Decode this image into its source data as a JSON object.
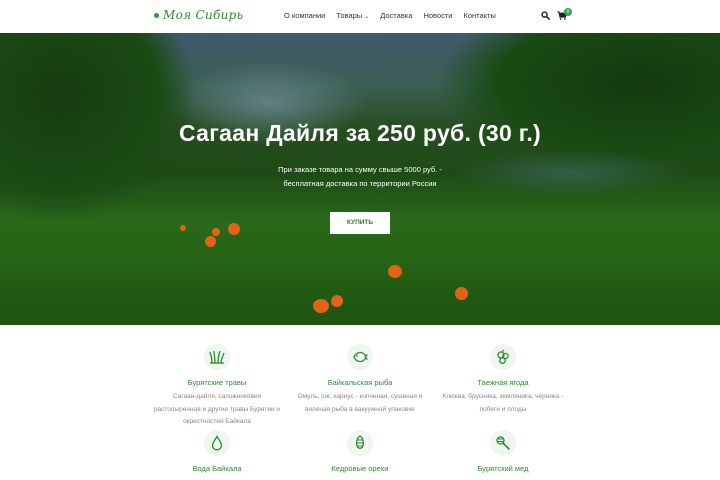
{
  "header": {
    "logo_text": "Моя Сибирь",
    "nav": [
      {
        "label": "О компании"
      },
      {
        "label": "Товары",
        "has_caret": true
      },
      {
        "label": "Доставка"
      },
      {
        "label": "Новости"
      },
      {
        "label": "Контакты"
      }
    ],
    "cart_count": "0",
    "icons": [
      "search-icon",
      "cart-icon"
    ],
    "accent_color": "#2e8b34"
  },
  "hero": {
    "title": "Сагаан Дайля за 250 руб. (30 г.)",
    "subtitle_line1": "При заказе товара на сумму свыше 5000 руб. -",
    "subtitle_line2": "бесплатная доставка по территории России",
    "button_label": "КУПИТЬ"
  },
  "categories": [
    {
      "icon": "herbs-icon",
      "title": "Бурятские травы",
      "desc": [
        "Сагаан-дайля, сапожниковия",
        "растопыренная и другие травы Бурятии и",
        "окрестностей Байкала"
      ]
    },
    {
      "icon": "fish-icon",
      "title": "Байкальская рыба",
      "desc": [
        "Омуль, сиг, хариус - копченая, сушеная и",
        "вяленая рыба в вакуумной упаковке"
      ]
    },
    {
      "icon": "berries-icon",
      "title": "Таежная ягода",
      "desc": [
        "Клюква, брусника, земляника, черника -",
        "побеги и плоды"
      ]
    },
    {
      "icon": "water-drop-icon",
      "title": "Вода Байкала",
      "desc": []
    },
    {
      "icon": "cedar-nut-icon",
      "title": "Кедровые орехи",
      "desc": []
    },
    {
      "icon": "honey-dipper-icon",
      "title": "Бурятский мед",
      "desc": []
    }
  ]
}
